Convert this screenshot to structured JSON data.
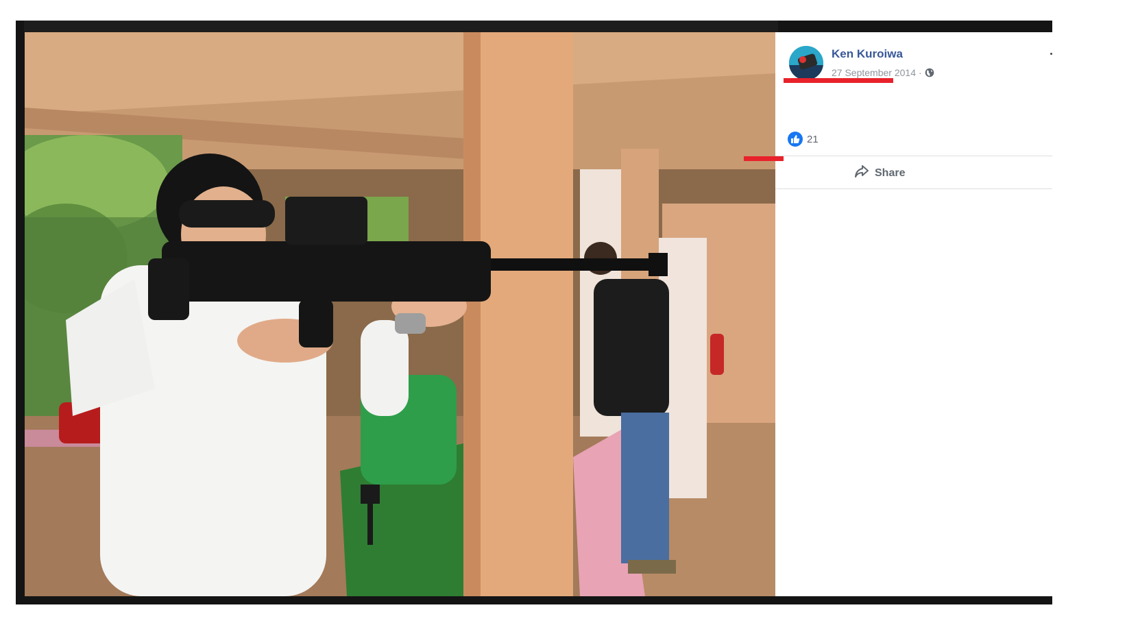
{
  "post": {
    "author_name": "Ken Kuroiwa",
    "date": "27 September 2014",
    "separator": "·",
    "privacy_icon": "globe-icon",
    "reaction_icon": "like-icon",
    "reaction_count": "21",
    "share_label": "Share",
    "share_icon": "share-arrow-icon"
  },
  "photo": {
    "description_icon": "photo"
  },
  "colors": {
    "author_link": "#385898",
    "like_blue": "#1877f2",
    "highlight_red": "#e8222b",
    "meta_gray": "#90949c"
  }
}
